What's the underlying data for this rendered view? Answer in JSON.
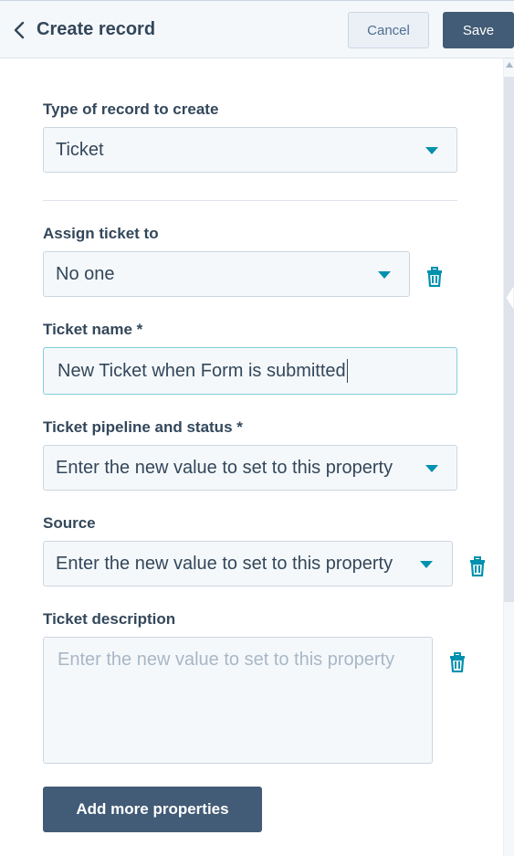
{
  "header": {
    "back_icon": "chevron-left-icon",
    "title": "Create record",
    "cancel_label": "Cancel",
    "save_label": "Save"
  },
  "form": {
    "record_type": {
      "label": "Type of record to create",
      "value": "Ticket"
    },
    "assign": {
      "label": "Assign ticket to",
      "value": "No one"
    },
    "ticket_name": {
      "label": "Ticket name *",
      "value": "New Ticket when Form is submitted"
    },
    "pipeline": {
      "label": "Ticket pipeline and status *",
      "value": "Enter the new value to set to this property"
    },
    "source": {
      "label": "Source",
      "value": "Enter the new value to set to this property"
    },
    "description": {
      "label": "Ticket description",
      "placeholder": "Enter the new value to set to this property"
    },
    "add_more_label": "Add more properties"
  },
  "icons": {
    "delete": "trash-icon",
    "dropdown": "caret-down-icon"
  },
  "colors": {
    "accent": "#0091ae",
    "primary_button": "#425b76",
    "text": "#33475b",
    "field_bg": "#f5f8fa"
  }
}
